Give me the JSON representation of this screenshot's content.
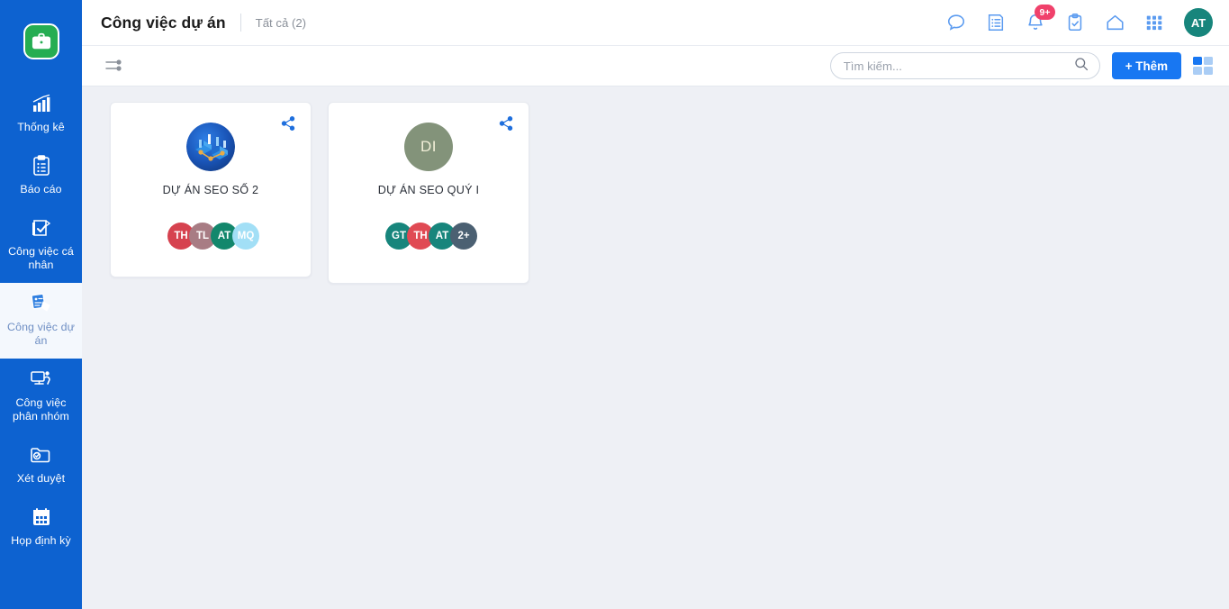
{
  "sidebar": {
    "brand_icon": "briefcase-icon",
    "brand_color": "#25ad52",
    "background_color": "#0d62d0",
    "items": [
      {
        "label": "Thống kê",
        "icon": "bar-chart-icon",
        "active": false
      },
      {
        "label": "Báo cáo",
        "icon": "clipboard-list-icon",
        "active": false
      },
      {
        "label": "Công việc cá nhân",
        "icon": "personal-task-icon",
        "active": false
      },
      {
        "label": "Công việc dự án",
        "icon": "project-task-icon",
        "active": true
      },
      {
        "label": "Công việc phân nhóm",
        "icon": "group-task-icon",
        "active": false
      },
      {
        "label": "Xét duyệt",
        "icon": "folder-check-icon",
        "active": false
      },
      {
        "label": "Họp định kỳ",
        "icon": "calendar-icon",
        "active": false
      }
    ]
  },
  "header": {
    "title": "Công việc dự án",
    "breadcrumb": "Tất cả (2)",
    "icons": [
      {
        "name": "chat-icon",
        "badge": ""
      },
      {
        "name": "news-feed-icon",
        "badge": ""
      },
      {
        "name": "notification-bell-icon",
        "badge": "9+"
      },
      {
        "name": "task-clipboard-icon",
        "badge": ""
      },
      {
        "name": "home-icon",
        "badge": ""
      },
      {
        "name": "apps-grid-icon",
        "badge": ""
      }
    ],
    "user_avatar": {
      "initials": "AT",
      "color": "#17857c"
    },
    "badge_color": "#f0416b"
  },
  "toolbar": {
    "filter_icon": "filter-sliders-icon",
    "search": {
      "placeholder": "Tìm kiếm...",
      "value": "",
      "icon": "search-icon"
    },
    "add_label": "+ Thêm",
    "add_color": "#1877f2",
    "view_toggle": {
      "icon": "grid-view-icon",
      "active_cell": 0
    }
  },
  "projects": [
    {
      "title": "DỰ ÁN SEO SỐ 2",
      "avatar_type": "image",
      "avatar_image": "seo-network-illustration",
      "share_icon": "share-icon",
      "members": [
        {
          "initials": "TH",
          "color": "#d6424f"
        },
        {
          "initials": "TL",
          "color": "#a87c84"
        },
        {
          "initials": "AT",
          "color": "#13876c"
        },
        {
          "initials": "MQ",
          "color": "#a2dff6"
        }
      ]
    },
    {
      "title": "DỰ ÁN SEO QUÝ I",
      "avatar_type": "initials",
      "avatar_initials": "DI",
      "avatar_color": "#83937a",
      "share_icon": "share-icon",
      "members": [
        {
          "initials": "GT",
          "color": "#17857c"
        },
        {
          "initials": "TH",
          "color": "#e04a54"
        },
        {
          "initials": "AT",
          "color": "#17857c"
        },
        {
          "initials": "2+",
          "color": "#4b6072"
        }
      ]
    }
  ]
}
